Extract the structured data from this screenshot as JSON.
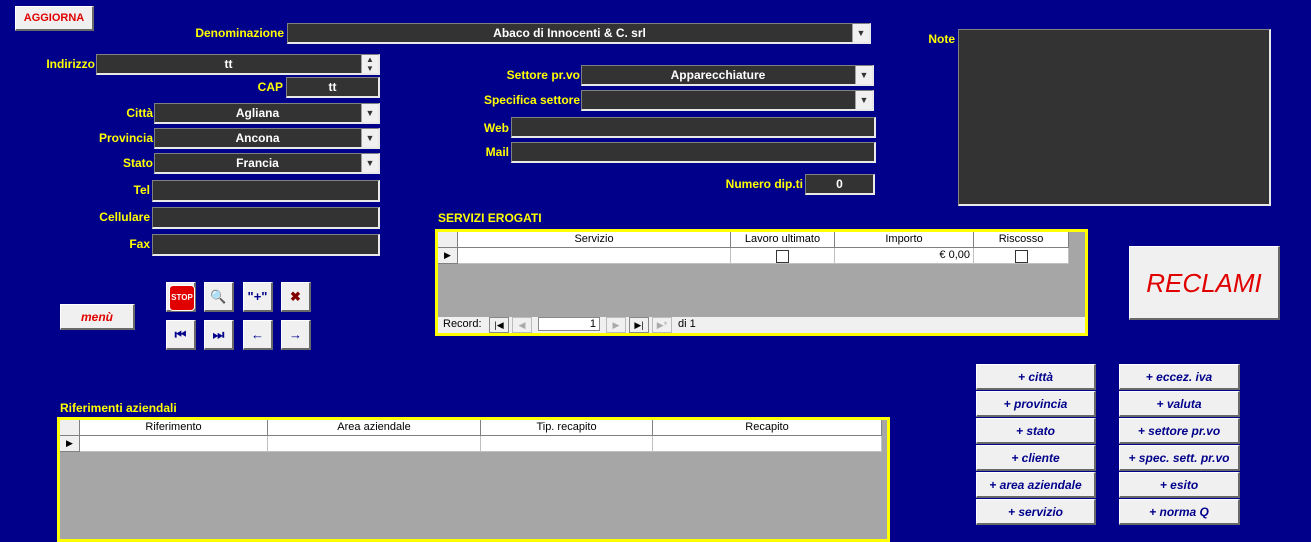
{
  "toolbar": {
    "aggiorna": "AGGIORNA",
    "menu": "menù"
  },
  "form": {
    "denominazione_label": "Denominazione",
    "denominazione_value": "Abaco di Innocenti & C. srl",
    "indirizzo_label": "Indirizzo",
    "indirizzo_value": "tt",
    "cap_label": "CAP",
    "cap_value": "tt",
    "citta_label": "Città",
    "citta_value": "Agliana",
    "provincia_label": "Provincia",
    "provincia_value": "Ancona",
    "stato_label": "Stato",
    "stato_value": "Francia",
    "tel_label": "Tel",
    "tel_value": "",
    "cellulare_label": "Cellulare",
    "cellulare_value": "",
    "fax_label": "Fax",
    "fax_value": "",
    "settore_label": "Settore pr.vo",
    "settore_value": "Apparecchiature",
    "specifica_label": "Specifica settore",
    "specifica_value": "",
    "web_label": "Web",
    "web_value": "",
    "mail_label": "Mail",
    "mail_value": "",
    "numero_dip_label": "Numero dip.ti",
    "numero_dip_value": "0",
    "note_label": "Note",
    "note_value": ""
  },
  "nav": {
    "stop": "STOP",
    "find": "🔍",
    "new": "\"+\"",
    "delete": "✖",
    "first": "⏮",
    "last": "⏭",
    "prev": "←",
    "next": "→"
  },
  "servizi": {
    "title": "SERVIZI EROGATI",
    "columns": [
      "Servizio",
      "Lavoro ultimato",
      "Importo",
      "Riscosso"
    ],
    "rows": [
      {
        "servizio": "",
        "lavoro_ultimato": false,
        "importo": "€ 0,00",
        "riscosso": false
      }
    ],
    "record_label": "Record:",
    "record_current": "1",
    "record_total": "di 1"
  },
  "reclami": "RECLAMI",
  "riferimenti": {
    "title": "Riferimenti aziendali",
    "columns": [
      "Riferimento",
      "Area aziendale",
      "Tip. recapito",
      "Recapito"
    ]
  },
  "add_buttons_left": [
    "+ città",
    "+ provincia",
    "+ stato",
    "+ cliente",
    "+ area aziendale",
    "+ servizio"
  ],
  "add_buttons_right": [
    "+ eccez. iva",
    "+ valuta",
    "+ settore pr.vo",
    "+ spec. sett. pr.vo",
    "+ esito",
    "+ norma Q"
  ],
  "colors": {
    "background": "#00008b",
    "label": "#ffff00",
    "field": "#333333",
    "accent_red": "#e00000"
  }
}
